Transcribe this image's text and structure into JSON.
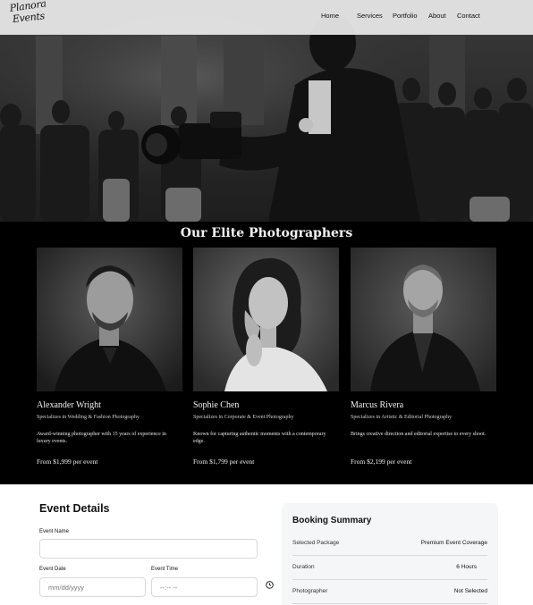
{
  "brand": {
    "logo_line1": "Planora",
    "logo_line2": "Events"
  },
  "nav": {
    "items": [
      "Home",
      "Services",
      "Portfolio",
      "About",
      "Contact"
    ]
  },
  "team": {
    "title": "Our Elite Photographers",
    "photographers": [
      {
        "name": "Alexander Wright",
        "specialty": "Specializes in Wedding & Fashion Photography",
        "bio": "Award-winning photographer with 15 years of experience in luxury events.",
        "price": "From $1,999 per event"
      },
      {
        "name": "Sophie Chen",
        "specialty": "Specializes in Corporate & Event Photography",
        "bio": "Known for capturing authentic moments with a contemporary edge.",
        "price": "From $1,799 per event"
      },
      {
        "name": "Marcus Rivera",
        "specialty": "Specializes in Artistic & Editorial Photography",
        "bio": "Brings creative direction and editorial expertise to every shoot.",
        "price": "From $2,199 per event"
      }
    ]
  },
  "form": {
    "title": "Event Details",
    "event_name_label": "Event Name",
    "event_name_value": "",
    "event_date_label": "Event Date",
    "event_date_placeholder": "mm/dd/yyyy",
    "event_time_label": "Event Time",
    "event_time_placeholder": "--:-- --"
  },
  "summary": {
    "title": "Booking Summary",
    "rows": [
      {
        "label": "Selected Package",
        "value": "Premium Event Coverage"
      },
      {
        "label": "Duration",
        "value": "6 Hours"
      },
      {
        "label": "Photographer",
        "value": "Not Selected"
      }
    ]
  }
}
